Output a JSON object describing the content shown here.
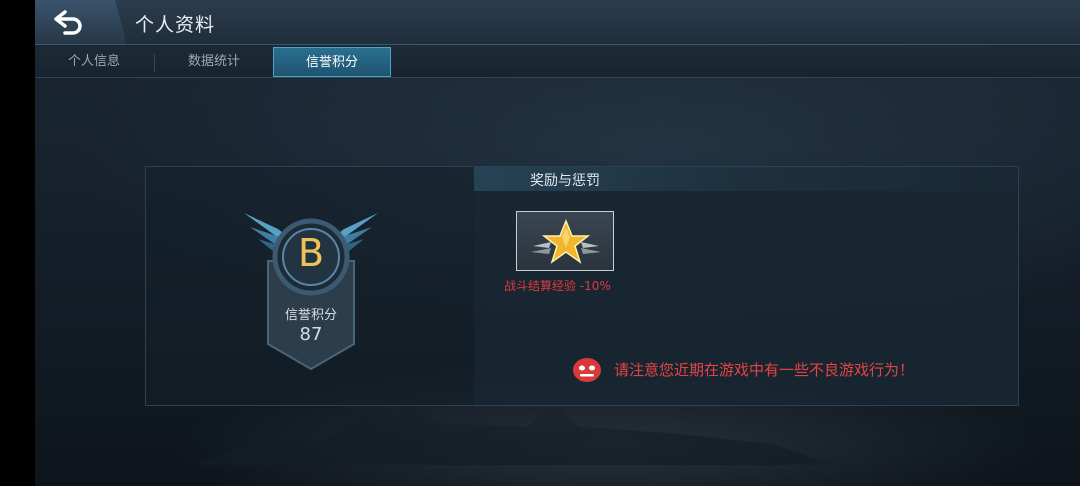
{
  "header": {
    "title": "个人资料"
  },
  "tabs": [
    {
      "label": "个人信息",
      "active": false
    },
    {
      "label": "数据统计",
      "active": false
    },
    {
      "label": "信誉积分",
      "active": true
    }
  ],
  "credit": {
    "grade": "B",
    "label": "信誉积分",
    "score": "87"
  },
  "rewards": {
    "title": "奖励与惩罚",
    "items": [
      {
        "icon": "gold-star-icon",
        "text": "战斗结算经验 -10%"
      }
    ],
    "warning": "请注意您近期在游戏中有一些不良游戏行为！"
  },
  "colors": {
    "accent": "#2a6f8f",
    "grade": "#f0c35a",
    "warning": "#e54343"
  }
}
